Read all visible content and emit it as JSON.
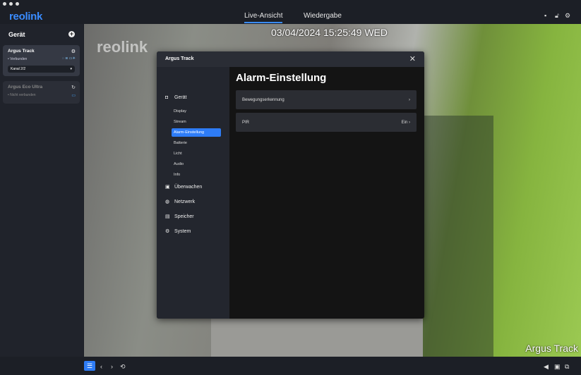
{
  "app": {
    "logo": "reolink",
    "tabs": [
      {
        "label": "Live-Ansicht",
        "active": true
      },
      {
        "label": "Wiedergabe",
        "active": false
      }
    ]
  },
  "sidebar": {
    "title": "Gerät",
    "devices": [
      {
        "name": "Argus Track",
        "status": "Verbunden",
        "channel": "Kanal 2/2"
      },
      {
        "name": "Argus Eco Ultra",
        "status": "Nicht verbunden"
      }
    ]
  },
  "video": {
    "timestamp": "03/04/2024 15:25:49 WED",
    "watermark": "reolink",
    "camera_name": "Argus Track"
  },
  "modal": {
    "title": "Argus Track",
    "heading": "Alarm-Einstellung",
    "nav": {
      "device": "Gerät",
      "sub": [
        "Display",
        "Stream",
        "Alarm-Einstellung",
        "Batterie",
        "Licht",
        "Audio",
        "Info"
      ],
      "groups": [
        "Überwachen",
        "Netzwerk",
        "Speicher",
        "System"
      ]
    },
    "rows": [
      {
        "label": "Bewegungserkennung",
        "value": ""
      },
      {
        "label": "PIR",
        "value": "Ein"
      }
    ]
  },
  "colors": {
    "accent": "#2e7cf6"
  }
}
